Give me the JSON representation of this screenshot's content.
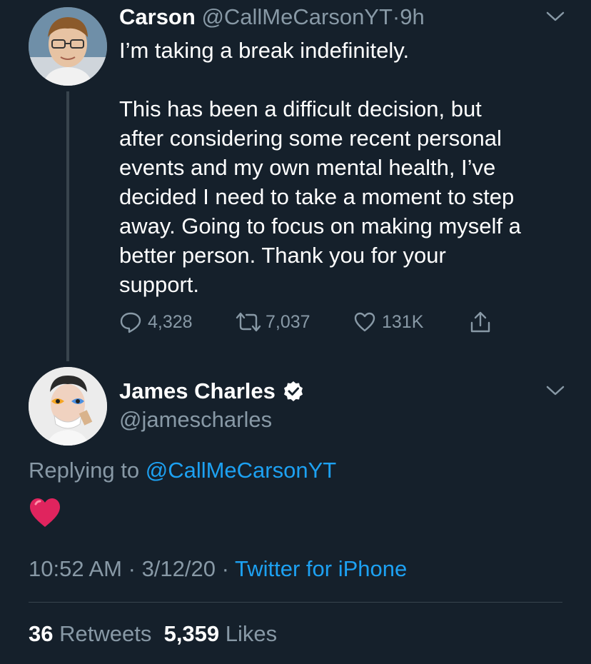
{
  "tweet1": {
    "name": "Carson",
    "handle": "@CallMeCarsonYT",
    "time": "9h",
    "sep": "·",
    "line1": "I’m taking a break indefinitely.",
    "lines": [
      "This has been a difficult decision, but",
      "after considering some recent personal",
      "events and my own mental health, I’ve",
      "decided I need to take a moment to step",
      "away. Going to focus on making myself a",
      "better person. Thank you for your",
      "support."
    ],
    "replies": "4,328",
    "retweets": "7,037",
    "likes": "131K"
  },
  "tweet2": {
    "name": "James Charles",
    "handle": "@jamescharles",
    "replying_prefix": "Replying to",
    "replying_handle": "@CallMeCarsonYT",
    "emoji": "❤️",
    "time": "10:52 AM",
    "date": "3/12/20",
    "sep": "·",
    "source": "Twitter for iPhone",
    "retweet_count": "36",
    "retweet_label": "Retweets",
    "like_count": "5,359",
    "like_label": "Likes"
  },
  "icons": {
    "reply": "reply-icon",
    "retweet": "retweet-icon",
    "like": "heart-icon",
    "share": "share-icon",
    "caret": "chevron-down-icon",
    "verified": "verified-badge-icon"
  },
  "colors": {
    "background": "#15202b",
    "muted": "#8899a6",
    "accent": "#1da1f2",
    "heart": "#e0245e"
  }
}
